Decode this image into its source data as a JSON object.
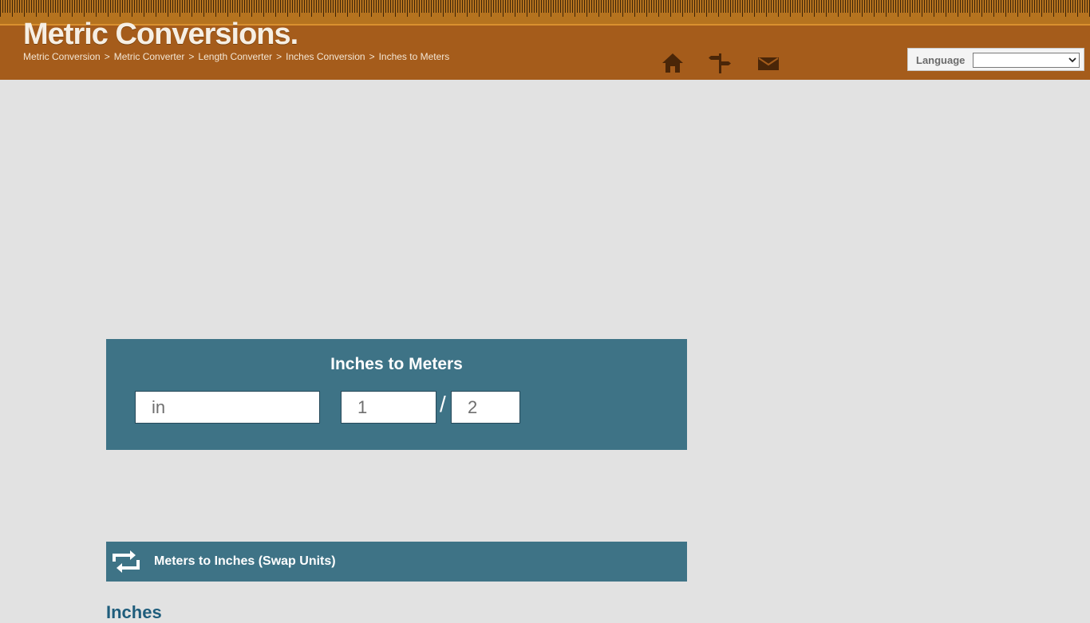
{
  "header": {
    "logo": "Metric Conversions.",
    "breadcrumb": [
      "Metric Conversion",
      "Metric Converter",
      "Length Converter",
      "Inches Conversion",
      "Inches to Meters"
    ],
    "separator": ">",
    "nav_icons": [
      "home-icon",
      "signpost-icon",
      "mail-icon"
    ],
    "language_label": "Language",
    "language_selected": ""
  },
  "converter": {
    "title": "Inches to Meters",
    "input_placeholder": "in",
    "fraction_numerator_placeholder": "1",
    "fraction_slash": "/",
    "fraction_denominator_placeholder": "2"
  },
  "swap": {
    "label": "Meters to Inches (Swap Units)",
    "icon": "swap-icon"
  },
  "section": {
    "heading": "Inches"
  },
  "colors": {
    "header_bg": "#a55c1b",
    "panel_bg": "#3e7386",
    "page_bg": "#e2e2e2",
    "heading": "#1f5d7c"
  }
}
